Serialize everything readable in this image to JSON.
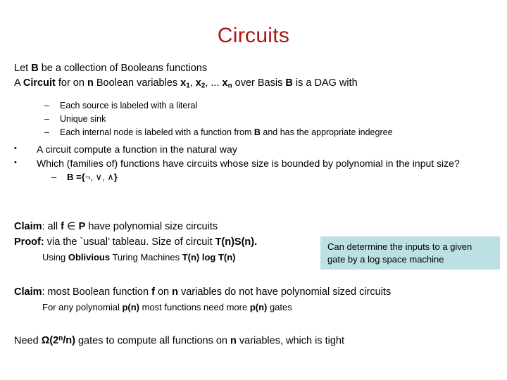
{
  "slide": {
    "title": "Circuits",
    "title_color": "#b01414",
    "background_color": "#ffffff",
    "intro": {
      "line1_pre": "Let ",
      "line1_bold": "B",
      "line1_post": " be a collection of Booleans functions",
      "line2_a": "A ",
      "line2_bold1": "Circuit",
      "line2_b": " for on ",
      "line2_bold2": "n",
      "line2_c": "  Boolean variables ",
      "var1": "x",
      "var1_sub": "1",
      "var2": "x",
      "var2_sub": "2",
      "ellipsis": ", ... ",
      "var3": "x",
      "var3_sub": "n",
      "line2_d": " over Basis ",
      "line2_bold3": "B",
      "line2_e": " is a DAG with"
    },
    "dash_bullets": [
      {
        "marker": "–",
        "text": "Each source is labeled with a literal"
      },
      {
        "marker": "–",
        "text": "Unique sink"
      },
      {
        "marker": "–",
        "text_pre": "Each internal node is labeled with a function from ",
        "bold": "B",
        "text_post": " and has the appropriate indegree"
      }
    ],
    "round_bullets": [
      {
        "marker": "•",
        "text": "A circuit compute a function in the natural way"
      },
      {
        "marker": "•",
        "text": "Which (families of) functions have circuits whose size is bounded by polynomial in the input size?"
      }
    ],
    "basis_line": {
      "marker": "–",
      "bold_b": "B",
      "equals": " ={",
      "not": "¬",
      "sep1": ", ",
      "or": "∨",
      "sep2": ", ",
      "and": "∧",
      "close": "}"
    },
    "claim1": {
      "label": "Claim",
      "colon": ": all  ",
      "f": "f",
      "member": " ∈ ",
      "p": "P",
      "rest": " have polynomial size circuits"
    },
    "proof": {
      "label": "Proof:",
      "text": " via the `usual’ tableau. Size of circuit ",
      "math": "T(n)S(n).",
      "sub_pre": "Using ",
      "sub_bold": "Oblivious",
      "sub_mid": " Turing Machines ",
      "sub_math": "T(n) log T(n)"
    },
    "callout": {
      "line1": "Can determine the inputs to a given",
      "line2": "gate by a log space machine",
      "background_color": "#bde0e4"
    },
    "claim2": {
      "label": "Claim",
      "text_a": ": most Boolean function ",
      "f": "f",
      "text_b": " on ",
      "n": "n",
      "text_c": " variables do not have polynomial sized circuits",
      "sub_a": "For any polynomial ",
      "sub_pn1": "p(n)",
      "sub_b": " most functions need more ",
      "sub_pn2": "p(n)",
      "sub_c": " gates"
    },
    "need_line": {
      "pre": "Need  ",
      "omega": "Ω(2",
      "exp": "n",
      "slash": "/n)",
      "mid": " gates to compute all functions on ",
      "n": "n",
      "post": " variables, which is tight"
    }
  }
}
